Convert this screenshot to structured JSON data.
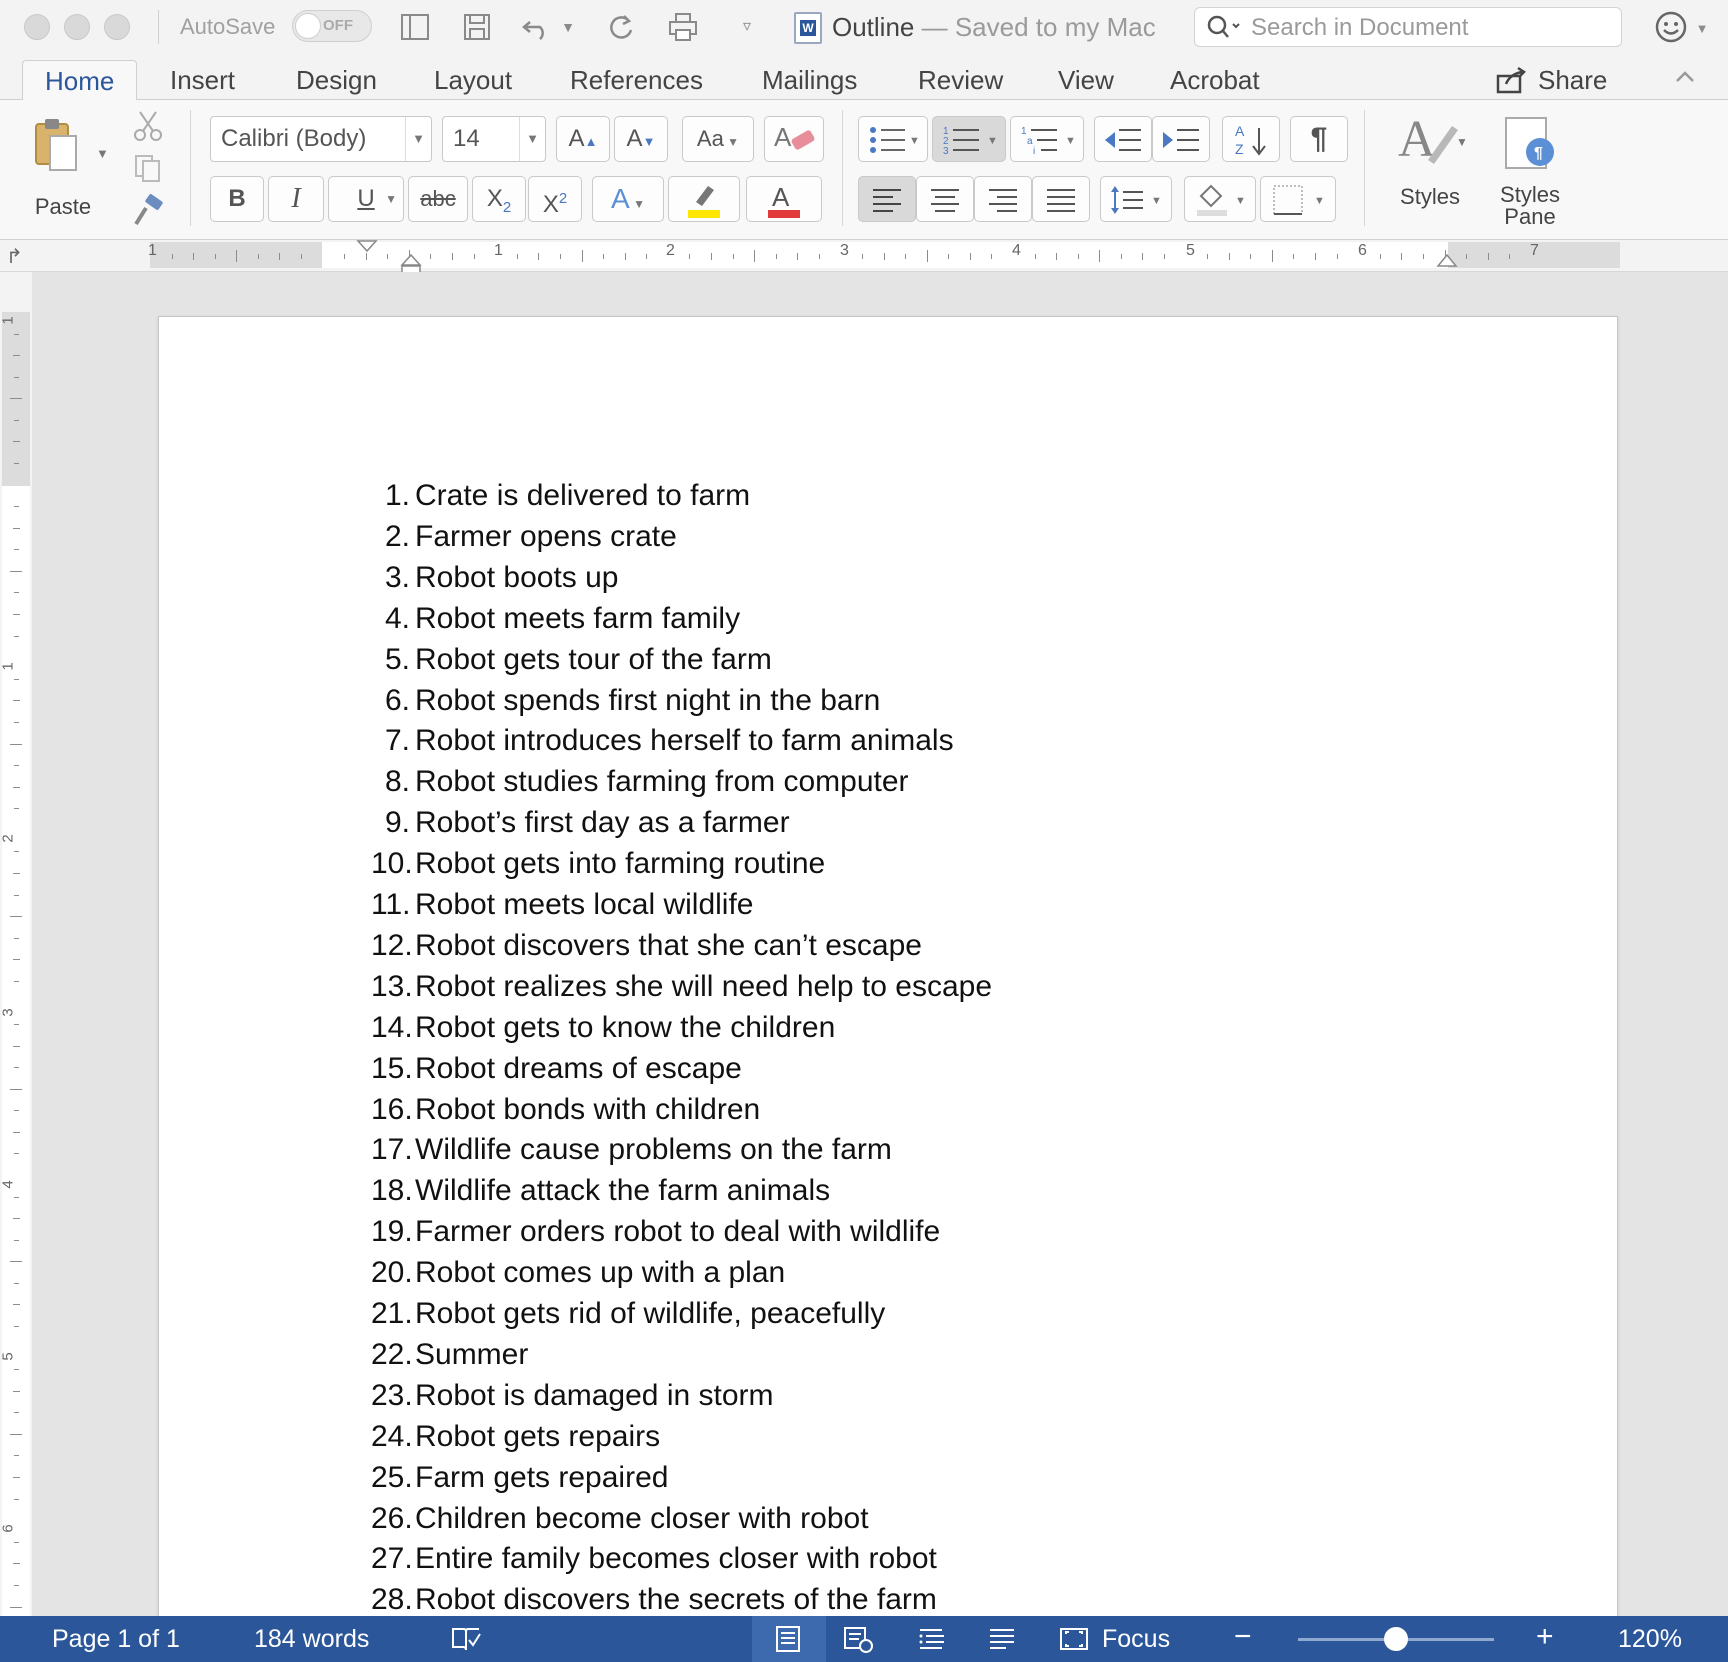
{
  "titlebar": {
    "autosave_label": "AutoSave",
    "autosave_toggle": "OFF",
    "doc_name": "Outline",
    "saved_status": " — Saved to my Mac",
    "search_placeholder": "Search in Document"
  },
  "tabs": [
    "Home",
    "Insert",
    "Design",
    "Layout",
    "References",
    "Mailings",
    "Review",
    "View",
    "Acrobat"
  ],
  "active_tab": "Home",
  "share_label": "Share",
  "ribbon": {
    "paste_label": "Paste",
    "font_name": "Calibri (Body)",
    "font_size": "14",
    "styles_label": "Styles",
    "styles_pane_label_1": "Styles",
    "styles_pane_label_2": "Pane",
    "bold": "B",
    "italic": "I",
    "underline": "U",
    "strike": "abc",
    "grow_font": "A",
    "shrink_font": "A",
    "pilcrow": "¶"
  },
  "ruler": {
    "numbers": [
      "1",
      "1",
      "2",
      "3",
      "4",
      "5",
      "6",
      "7"
    ]
  },
  "vruler": {
    "numbers": [
      "1",
      "1",
      "2",
      "3",
      "4",
      "5",
      "6"
    ]
  },
  "document": {
    "items": [
      {
        "n": "1.",
        "text": "Crate is delivered to farm"
      },
      {
        "n": "2.",
        "text": "Farmer opens crate"
      },
      {
        "n": "3.",
        "text": "Robot boots up"
      },
      {
        "n": "4.",
        "text": "Robot meets farm family"
      },
      {
        "n": "5.",
        "text": "Robot gets tour of the farm"
      },
      {
        "n": "6.",
        "text": "Robot spends first night in the barn"
      },
      {
        "n": "7.",
        "text": "Robot introduces herself to farm animals"
      },
      {
        "n": "8.",
        "text": "Robot studies farming from computer"
      },
      {
        "n": "9.",
        "text": "Robot’s first day as a farmer"
      },
      {
        "n": "10.",
        "text": "Robot gets into farming routine"
      },
      {
        "n": "11.",
        "text": "Robot meets local wildlife"
      },
      {
        "n": "12.",
        "text": "Robot discovers that she can’t escape"
      },
      {
        "n": "13.",
        "text": "Robot realizes she will need help to escape"
      },
      {
        "n": "14.",
        "text": "Robot gets to know the children"
      },
      {
        "n": "15.",
        "text": "Robot dreams of escape"
      },
      {
        "n": "16.",
        "text": "Robot bonds with children"
      },
      {
        "n": "17.",
        "text": "Wildlife cause problems on the farm"
      },
      {
        "n": "18.",
        "text": "Wildlife attack the farm animals"
      },
      {
        "n": "19.",
        "text": "Farmer orders robot to deal with wildlife"
      },
      {
        "n": "20.",
        "text": "Robot comes up with a plan"
      },
      {
        "n": "21.",
        "text": "Robot gets rid of wildlife, peacefully"
      },
      {
        "n": "22.",
        "text": "Summer"
      },
      {
        "n": "23.",
        "text": "Robot is damaged in storm"
      },
      {
        "n": "24.",
        "text": "Robot gets repairs"
      },
      {
        "n": "25.",
        "text": "Farm gets repaired"
      },
      {
        "n": "26.",
        "text": "Children become closer with robot"
      },
      {
        "n": "27.",
        "text": "Entire family becomes closer with robot"
      },
      {
        "n": "28.",
        "text": "Robot discovers the secrets of the farm"
      }
    ]
  },
  "statusbar": {
    "page": "Page 1 of 1",
    "words": "184 words",
    "focus": "Focus",
    "zoom_minus": "−",
    "zoom_plus": "+",
    "zoom": "120%",
    "zoom_fraction": 0.5
  },
  "colors": {
    "accent": "#2b579a",
    "highlight": "#ffe600",
    "font_color": "#e23b3b"
  }
}
